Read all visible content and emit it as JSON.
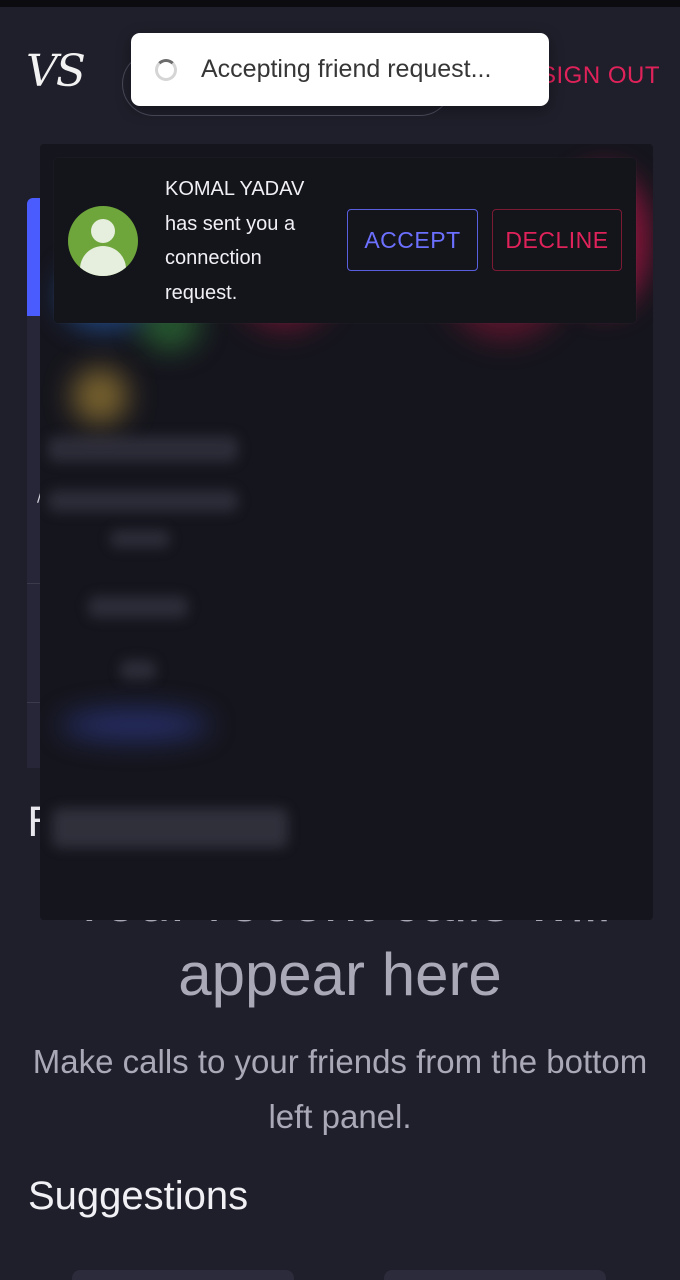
{
  "header": {
    "logo_text": "VS",
    "signout_label": "SIGN OUT"
  },
  "toast": {
    "message": "Accepting friend request..."
  },
  "notification": {
    "line1": "KOMAL YADAV",
    "line2": "has sent you a",
    "line3": "connection",
    "line4": "request.",
    "accept_label": "ACCEPT",
    "decline_label": "DECLINE"
  },
  "recent_calls": {
    "empty_line1": "Your recent calls will",
    "empty_line2": "appear here",
    "hint": "Make calls to your friends from the bottom left panel."
  },
  "suggestions": {
    "title": "Suggestions"
  },
  "colors": {
    "background": "#1f1f2b",
    "accent_blue": "#6c70ff",
    "accent_red": "#e0225a",
    "avatar_green": "#6ea63c"
  }
}
